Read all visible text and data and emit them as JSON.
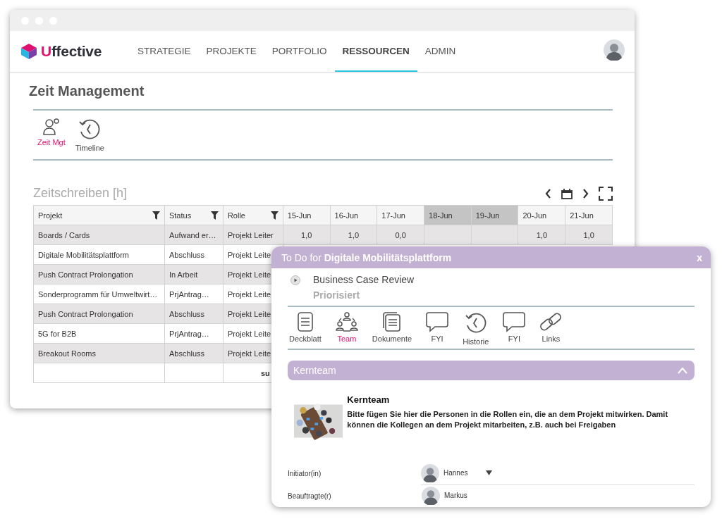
{
  "app": {
    "logo": "Uffective"
  },
  "nav": [
    {
      "label": "STRATEGIE",
      "selected": false
    },
    {
      "label": "PROJEKTE",
      "selected": false
    },
    {
      "label": "PORTFOLIO",
      "selected": false
    },
    {
      "label": "RESSOURCEN",
      "selected": true
    },
    {
      "label": "ADMIN",
      "selected": false
    }
  ],
  "page": {
    "title": "Zeit Management"
  },
  "toolbar": [
    {
      "label": "Zeit Mgt",
      "kind": "person-clock",
      "selected": true
    },
    {
      "label": "Timeline",
      "kind": "history",
      "selected": false
    }
  ],
  "timesheet": {
    "title": "Zeitschreiben [h]",
    "columns": [
      {
        "label": "Projekt",
        "filter": true
      },
      {
        "label": "Status",
        "filter": true
      },
      {
        "label": "Rolle",
        "filter": true
      }
    ],
    "dates": [
      {
        "label": "15-Jun",
        "weekend": false
      },
      {
        "label": "16-Jun",
        "weekend": false
      },
      {
        "label": "17-Jun",
        "weekend": false
      },
      {
        "label": "18-Jun",
        "weekend": true
      },
      {
        "label": "19-Jun",
        "weekend": true
      },
      {
        "label": "20-Jun",
        "weekend": false
      },
      {
        "label": "21-Jun",
        "weekend": false
      }
    ],
    "rows": [
      {
        "project": "Boards / Cards",
        "status": "Aufwand er…",
        "role": "Projekt Leiter",
        "hours": [
          "1,0",
          "1,0",
          "0,0",
          "1,0",
          "1,0"
        ]
      },
      {
        "project": "Digitale Mobilitätsplattform",
        "status": "Abschluss",
        "role": "Projekt Leite"
      },
      {
        "project": "Push Contract Prolongation",
        "status": "In Arbeit",
        "role": "Projekt Leite"
      },
      {
        "project": "Sonderprogramm für Umweltwirt…",
        "status": "PrjAntrag…",
        "role": "Projekt Leite"
      },
      {
        "project": "Push Contract Prolongation",
        "status": "Abschluss",
        "role": "Projekt Leite"
      },
      {
        "project": "5G for B2B",
        "status": "PrjAntrag…",
        "role": "Projekt Leite"
      },
      {
        "project": "Breakout Rooms",
        "status": "Abschluss",
        "role": "Projekt Leite"
      }
    ],
    "sum_label": "su"
  },
  "dialog": {
    "title": "To Do for **Digitale Mobilitätsplattform**",
    "close": "x",
    "task": "Business Case Review",
    "state": "Priorisiert",
    "tabs": [
      {
        "label": "Deckblatt",
        "kind": "document",
        "selected": false
      },
      {
        "label": "Team",
        "kind": "team",
        "selected": true
      },
      {
        "label": "Dokumente",
        "kind": "documents",
        "selected": false
      },
      {
        "label": "FYI",
        "kind": "speech",
        "selected": false
      },
      {
        "label": "Historie",
        "kind": "history",
        "selected": false
      },
      {
        "label": "FYI",
        "kind": "speech",
        "selected": false
      },
      {
        "label": "Links",
        "kind": "link",
        "selected": false
      }
    ],
    "section": {
      "title": "Kernteam",
      "expanded": true,
      "card": {
        "kind": "picture",
        "heading": "Kernteam",
        "text": "Bitte fügen Sie hier die Personen in die Rollen ein, die an dem Projekt mitwirken. Damit können die Kollegen an dem Projekt mitarbeiten, z.B. auch bei Freigaben"
      }
    },
    "fields": [
      {
        "label": "Initiator(in)",
        "value": "Hannes",
        "dropdown": true
      },
      {
        "label": "Beauftragte(r)",
        "value": "Markus",
        "dropdown": false
      }
    ]
  }
}
